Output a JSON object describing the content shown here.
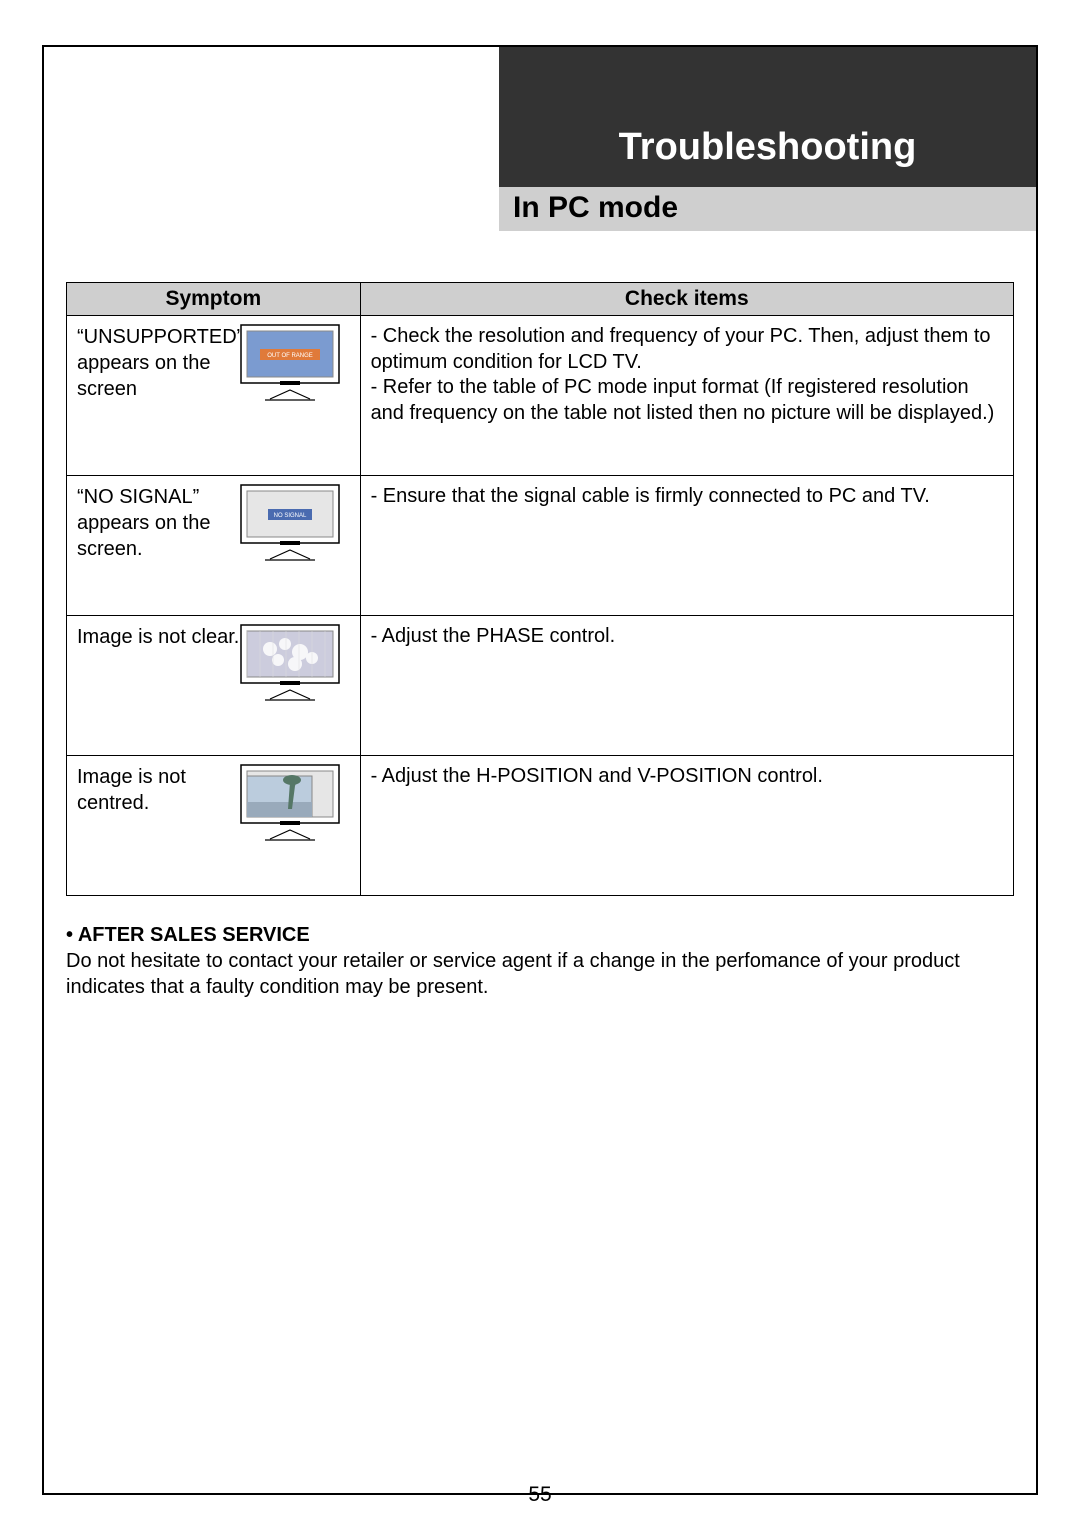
{
  "header": {
    "title": "Troubleshooting",
    "subtitle": "In PC mode"
  },
  "table": {
    "col1": "Symptom",
    "col2": "Check items",
    "rows": [
      {
        "symptom": "“UNSUPPORTED” appears on the screen",
        "screen_label": "OUT OF RANGE",
        "check": "- Check the resolution and frequency of your PC. Then, adjust them to optimum condition for LCD TV.\n- Refer to the table of PC mode input format (If registered resolution and frequency on the table not listed then no picture will be displayed.)",
        "fig": "message-orange"
      },
      {
        "symptom": "“NO SIGNAL” appears on the screen.",
        "screen_label": "NO SIGNAL",
        "check": "- Ensure that the signal cable is firmly connected to PC and TV.",
        "fig": "message-blue"
      },
      {
        "symptom": "Image is not clear.",
        "screen_label": "",
        "check": "- Adjust the PHASE control.",
        "fig": "flowers"
      },
      {
        "symptom": "Image is not centred.",
        "screen_label": "",
        "check": "- Adjust the H-POSITION and V-POSITION control.",
        "fig": "landscape"
      }
    ]
  },
  "after": {
    "title": "• AFTER SALES SERVICE",
    "body": "Do not hesitate to contact your retailer or service agent if a change in the perfomance of your product indicates that a faulty condition may be present."
  },
  "page_number": "55"
}
